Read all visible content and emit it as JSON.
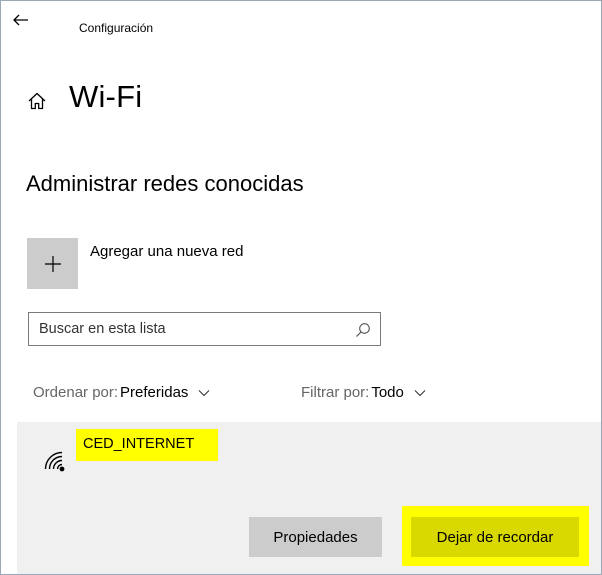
{
  "titlebar": {
    "back_icon": "arrow-left-icon",
    "app_title": "Configuración"
  },
  "header": {
    "home_icon": "home-icon",
    "title": "Wi-Fi"
  },
  "section": {
    "title": "Administrar redes conocidas"
  },
  "add_network": {
    "icon": "plus-icon",
    "label": "Agregar una nueva red"
  },
  "search": {
    "placeholder": "Buscar en esta lista",
    "value": "",
    "icon": "search-icon"
  },
  "sort": {
    "label": "Ordenar por:",
    "value": "Preferidas"
  },
  "filter": {
    "label": "Filtrar por:",
    "value": "Todo"
  },
  "networks": [
    {
      "name": "CED_INTERNET",
      "icon": "wifi-icon",
      "properties_label": "Propiedades",
      "forget_label": "Dejar de recordar"
    }
  ],
  "colors": {
    "highlight": "#ffff00",
    "tile_gray": "#cccccc",
    "panel_bg": "#f0f0f0",
    "forget_button_bg": "#d9d900"
  }
}
